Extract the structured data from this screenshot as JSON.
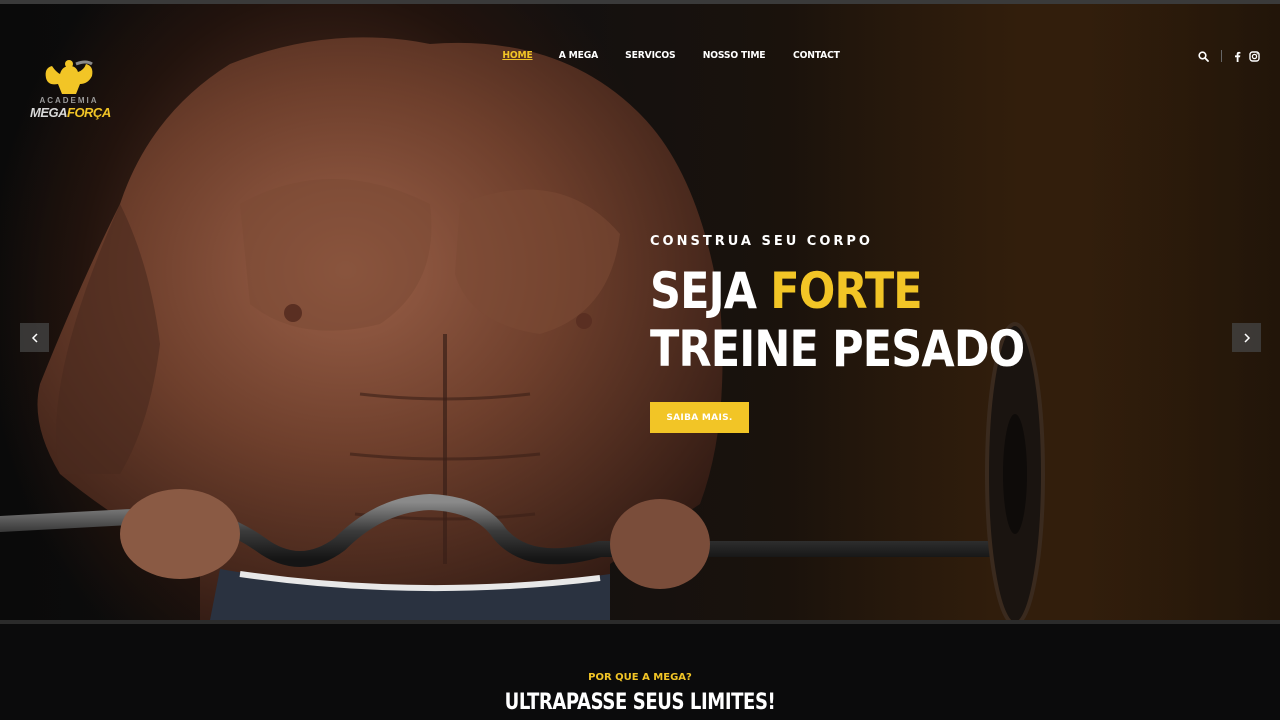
{
  "brand": {
    "logo_small": "ACADEMIA",
    "logo_big_white": "MEGA",
    "logo_big_yellow": "FORÇA",
    "accent": "#f2c526"
  },
  "nav": {
    "items": [
      {
        "label": "HOME",
        "active": true
      },
      {
        "label": "A MEGA"
      },
      {
        "label": "SERVICOS"
      },
      {
        "label": "NOSSO TIME"
      },
      {
        "label": "CONTACT"
      }
    ],
    "icons": [
      "search-icon",
      "facebook-icon",
      "instagram-icon"
    ]
  },
  "hero": {
    "subtitle": "CONSTRUA SEU CORPO",
    "headline_part1": "SEJA ",
    "headline_highlight": "FORTE",
    "headline_line2": "TREINE PESADO",
    "cta_label": "SAIBA MAIS.",
    "prev_icon": "chevron-left-icon",
    "next_icon": "chevron-right-icon"
  },
  "section": {
    "kicker": "POR QUE A MEGA?",
    "title": "ULTRAPASSE SEUS LIMITES!"
  }
}
